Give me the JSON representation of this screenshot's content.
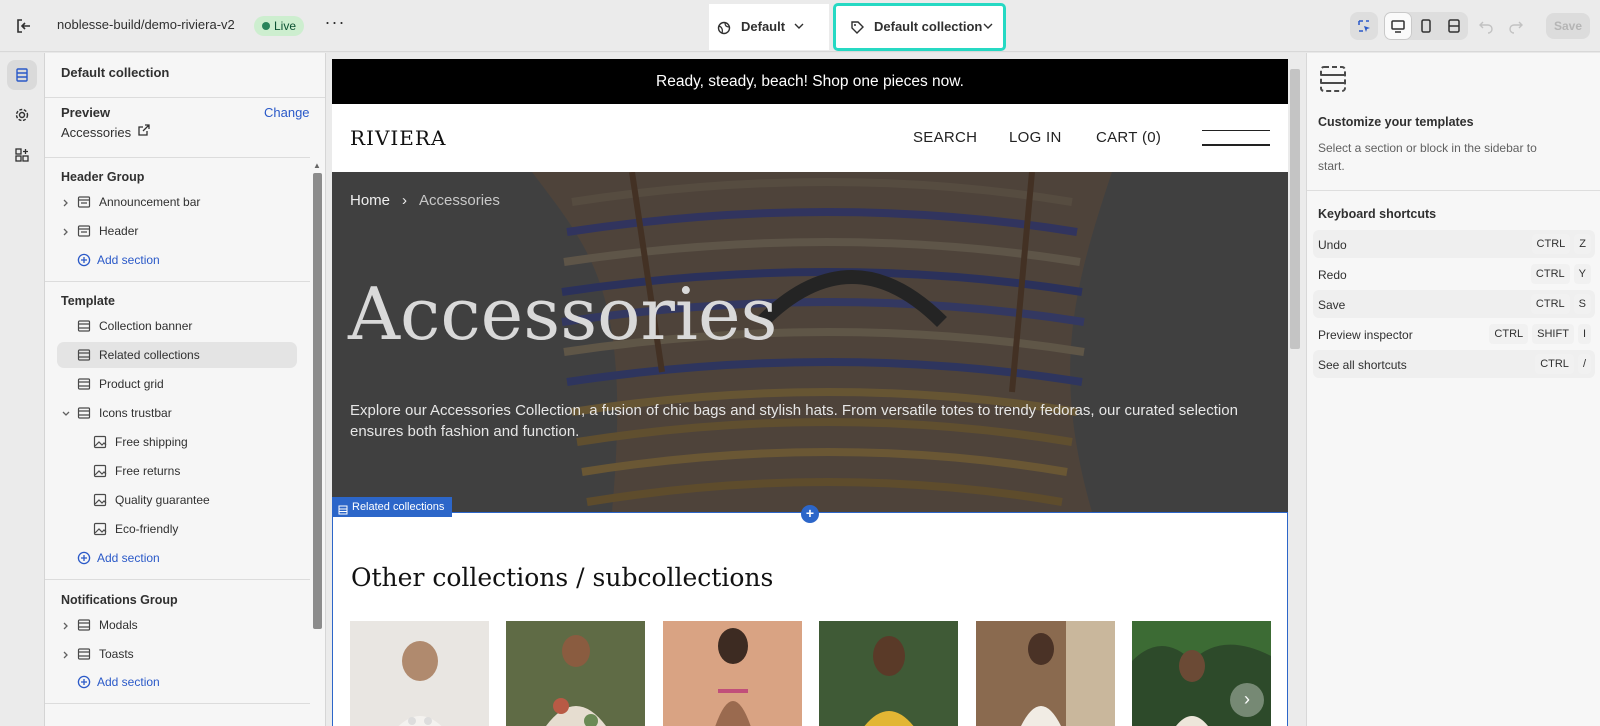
{
  "topbar": {
    "store_name": "noblesse-build/demo-riviera-v2",
    "live_label": "Live",
    "theme_selector": "Default",
    "template_selector": "Default collection",
    "save_label": "Save",
    "highlight_color": "#26d9c3"
  },
  "sidebar": {
    "title": "Default collection",
    "preview_label": "Preview",
    "change_label": "Change",
    "preview_value": "Accessories",
    "header_group": {
      "title": "Header Group",
      "items": [
        "Announcement bar",
        "Header"
      ],
      "add_label": "Add section"
    },
    "template": {
      "title": "Template",
      "items": [
        "Collection banner",
        "Related collections",
        "Product grid",
        "Icons trustbar"
      ],
      "children": [
        "Free shipping",
        "Free returns",
        "Quality guarantee",
        "Eco-friendly"
      ],
      "add_label": "Add section"
    },
    "notifications_group": {
      "title": "Notifications Group",
      "items": [
        "Modals",
        "Toasts"
      ],
      "add_label": "Add section"
    }
  },
  "preview": {
    "announcement": "Ready, steady, beach! Shop one pieces now.",
    "logo": "RIVIERA",
    "nav": [
      "SEARCH",
      "LOG IN",
      "CART (0)"
    ],
    "breadcrumb": {
      "home": "Home",
      "sep": "›",
      "current": "Accessories"
    },
    "hero_title": "Accessories",
    "hero_desc": "Explore our Accessories Collection, a fusion of chic bags and stylish hats. From versatile totes to trendy fedoras, our curated selection ensures both fashion and function.",
    "section_tag": "Related collections",
    "related_title": "Other collections / subcollections",
    "next_glyph": "›",
    "accent_color": "#2c66c9"
  },
  "right_panel": {
    "title": "Customize your templates",
    "description": "Select a section or block in the sidebar to start.",
    "shortcuts_title": "Keyboard shortcuts",
    "shortcuts": [
      {
        "name": "Undo",
        "keys": [
          "CTRL",
          "Z"
        ]
      },
      {
        "name": "Redo",
        "keys": [
          "CTRL",
          "Y"
        ]
      },
      {
        "name": "Save",
        "keys": [
          "CTRL",
          "S"
        ]
      },
      {
        "name": "Preview inspector",
        "keys": [
          "CTRL",
          "SHIFT",
          "I"
        ]
      },
      {
        "name": "See all shortcuts",
        "keys": [
          "CTRL",
          "/"
        ]
      }
    ]
  }
}
